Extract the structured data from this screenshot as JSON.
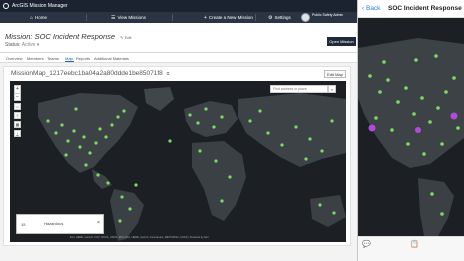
{
  "desktop": {
    "app_title": "ArcGIS Mission Manager",
    "nav": {
      "home_label": "Home",
      "view_missions_label": "View Missions",
      "create_mission_label": "Create a New Mission",
      "settings_label": "Settings",
      "user_name": "Public Safety Admin"
    },
    "mission": {
      "title": "Mission: SOC Incident Response",
      "edit_label": "Edit",
      "status_label": "Status:",
      "status_value": "Active",
      "open_button": "Open Mission"
    },
    "tabs": [
      "Overview",
      "Members",
      "Teams",
      "Map",
      "Reports",
      "Additional Materials"
    ],
    "active_tab": "Map",
    "map": {
      "name": "MissionMap_1217eebc1ba04a2a80ddde1be85071f8",
      "edit_map_label": "Edit Map",
      "search_placeholder": "Find address or place",
      "scale_indicator": "15",
      "scale_value": "Hazardous",
      "attribution": "Esri, HERE, Garmin, FAO, NOAA, USGS, EPA | Esri, HERE, Garmin, Foursquare, METI/NASA, USGS | Powered by Esri"
    }
  },
  "mobile": {
    "back_label": "Back",
    "title": "SOC Incident Response"
  },
  "colors": {
    "accent": "#2468a8",
    "marker": "#7ddc5e",
    "marker_alert": "#b04bdc",
    "header_dark": "#1c2330"
  }
}
